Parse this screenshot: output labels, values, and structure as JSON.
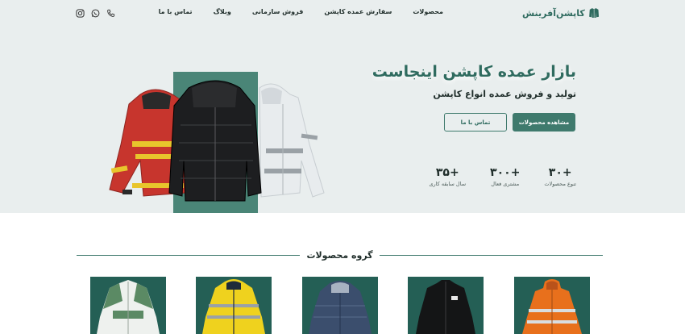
{
  "brand": {
    "name": "کاپشن‌آفرینش"
  },
  "nav": {
    "items": [
      {
        "label": "محصولات"
      },
      {
        "label": "سفارش عمده کاپشن"
      },
      {
        "label": "فروش سازمانی"
      },
      {
        "label": "وبلاگ"
      },
      {
        "label": "تماس با ما"
      }
    ]
  },
  "social": [
    "phone-icon",
    "whatsapp-icon",
    "instagram-icon"
  ],
  "hero": {
    "title": "بازار عمده کاپشن اینجاست",
    "subtitle": "تولید و فروش عمده انواع کاپشن",
    "primary_button": "مشاهده محصولات",
    "secondary_button": "تماس با ما",
    "stats": [
      {
        "value": "+۳۰",
        "label": "تنوع محصولات"
      },
      {
        "value": "+۳۰۰",
        "label": "مشتری فعال"
      },
      {
        "value": "+۳۵",
        "label": "سال سابقه کاری"
      }
    ]
  },
  "products_section": {
    "title": "گروه محصولات",
    "items": [
      {
        "name": "orange-reflective-jacket"
      },
      {
        "name": "black-softshell-jacket"
      },
      {
        "name": "denim-puffer-jacket"
      },
      {
        "name": "yellow-reflective-jacket"
      },
      {
        "name": "green-white-varsity-jacket"
      }
    ]
  },
  "colors": {
    "accent": "#3f7a6d",
    "brand": "#2f6b5f",
    "hero_bg": "#e9eeee",
    "tile_bg": "#245f55"
  }
}
